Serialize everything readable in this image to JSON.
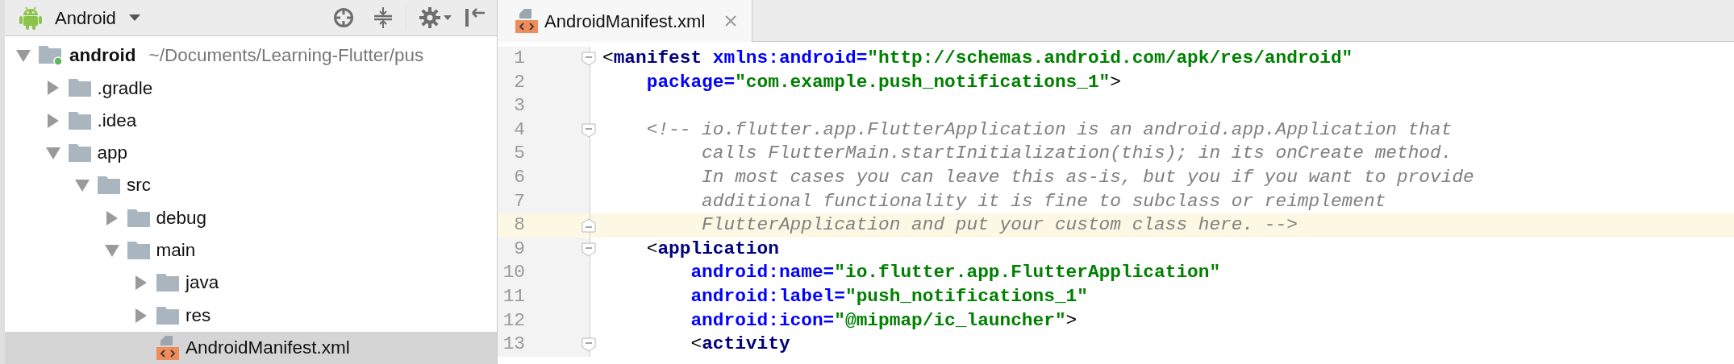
{
  "project_panel": {
    "view_selector": "Android",
    "tree": [
      {
        "label": "android",
        "path": "~/Documents/Learning-Flutter/pus",
        "kind": "module",
        "expanded": true,
        "selected": false,
        "children": [
          {
            "label": ".gradle",
            "kind": "folder",
            "expanded": false,
            "selected": false
          },
          {
            "label": ".idea",
            "kind": "folder",
            "expanded": false,
            "selected": false
          },
          {
            "label": "app",
            "kind": "folder",
            "expanded": true,
            "selected": false,
            "children": [
              {
                "label": "src",
                "kind": "folder",
                "expanded": true,
                "selected": false,
                "children": [
                  {
                    "label": "debug",
                    "kind": "folder",
                    "expanded": false,
                    "selected": false
                  },
                  {
                    "label": "main",
                    "kind": "folder",
                    "expanded": true,
                    "selected": false,
                    "children": [
                      {
                        "label": "java",
                        "kind": "folder",
                        "expanded": false,
                        "selected": false
                      },
                      {
                        "label": "res",
                        "kind": "folder",
                        "expanded": false,
                        "selected": false
                      },
                      {
                        "label": "AndroidManifest.xml",
                        "kind": "xml",
                        "selected": true
                      }
                    ]
                  }
                ]
              }
            ]
          }
        ]
      }
    ]
  },
  "editor": {
    "tabs": [
      {
        "label": "AndroidManifest.xml",
        "selected": true
      }
    ],
    "lines": [
      {
        "number": "1",
        "fold_open": true,
        "fold_close": false,
        "current": false,
        "tokens": [
          {
            "kind": "punct",
            "text": "<"
          },
          {
            "kind": "tag",
            "text": "manifest "
          },
          {
            "kind": "attr",
            "text": "xmlns:android="
          },
          {
            "kind": "value",
            "text": "\"http://schemas.android.com/apk/res/android\""
          }
        ]
      },
      {
        "number": "2",
        "fold_open": false,
        "fold_close": false,
        "current": false,
        "tokens": [
          {
            "kind": "attr",
            "text": "    package="
          },
          {
            "kind": "value",
            "text": "\"com.example.push_notifications_1\""
          },
          {
            "kind": "punct",
            "text": ">"
          }
        ]
      },
      {
        "number": "3",
        "fold_open": false,
        "fold_close": false,
        "current": false
      },
      {
        "number": "4",
        "fold_open": true,
        "fold_close": false,
        "current": false,
        "tokens": [
          {
            "kind": "comment",
            "text": "    <!-- io.flutter.app.FlutterApplication is an android.app.Application that"
          }
        ]
      },
      {
        "number": "5",
        "fold_open": false,
        "fold_close": false,
        "current": false,
        "tokens": [
          {
            "kind": "comment",
            "text": "         calls FlutterMain.startInitialization(this); in its onCreate method."
          }
        ]
      },
      {
        "number": "6",
        "fold_open": false,
        "fold_close": false,
        "current": false,
        "tokens": [
          {
            "kind": "comment",
            "text": "         In most cases you can leave this as-is, but you if you want to provide"
          }
        ]
      },
      {
        "number": "7",
        "fold_open": false,
        "fold_close": false,
        "current": false,
        "tokens": [
          {
            "kind": "comment",
            "text": "         additional functionality it is fine to subclass or reimplement"
          }
        ]
      },
      {
        "number": "8",
        "fold_open": false,
        "fold_close": true,
        "current": true,
        "tokens": [
          {
            "kind": "comment",
            "text": "         FlutterApplication and put your custom class here. -->"
          }
        ]
      },
      {
        "number": "9",
        "fold_open": true,
        "fold_close": false,
        "current": false,
        "tokens": [
          {
            "kind": "punct",
            "text": "    <"
          },
          {
            "kind": "tag",
            "text": "application"
          }
        ]
      },
      {
        "number": "10",
        "fold_open": false,
        "fold_close": false,
        "current": false,
        "tokens": [
          {
            "kind": "attr",
            "text": "        android:name="
          },
          {
            "kind": "value",
            "text": "\"io.flutter.app.FlutterApplication\""
          }
        ]
      },
      {
        "number": "11",
        "fold_open": false,
        "fold_close": false,
        "current": false,
        "tokens": [
          {
            "kind": "attr",
            "text": "        android:label="
          },
          {
            "kind": "value",
            "text": "\"push_notifications_1\""
          }
        ]
      },
      {
        "number": "12",
        "fold_open": false,
        "fold_close": false,
        "current": false,
        "tokens": [
          {
            "kind": "attr",
            "text": "        android:icon="
          },
          {
            "kind": "value",
            "text": "\"@mipmap/ic_launcher\""
          },
          {
            "kind": "punct",
            "text": ">"
          }
        ]
      },
      {
        "number": "13",
        "fold_open": true,
        "fold_close": false,
        "current": false,
        "tokens": [
          {
            "kind": "punct",
            "text": "        <"
          },
          {
            "kind": "tag",
            "text": "activity"
          }
        ]
      }
    ]
  }
}
